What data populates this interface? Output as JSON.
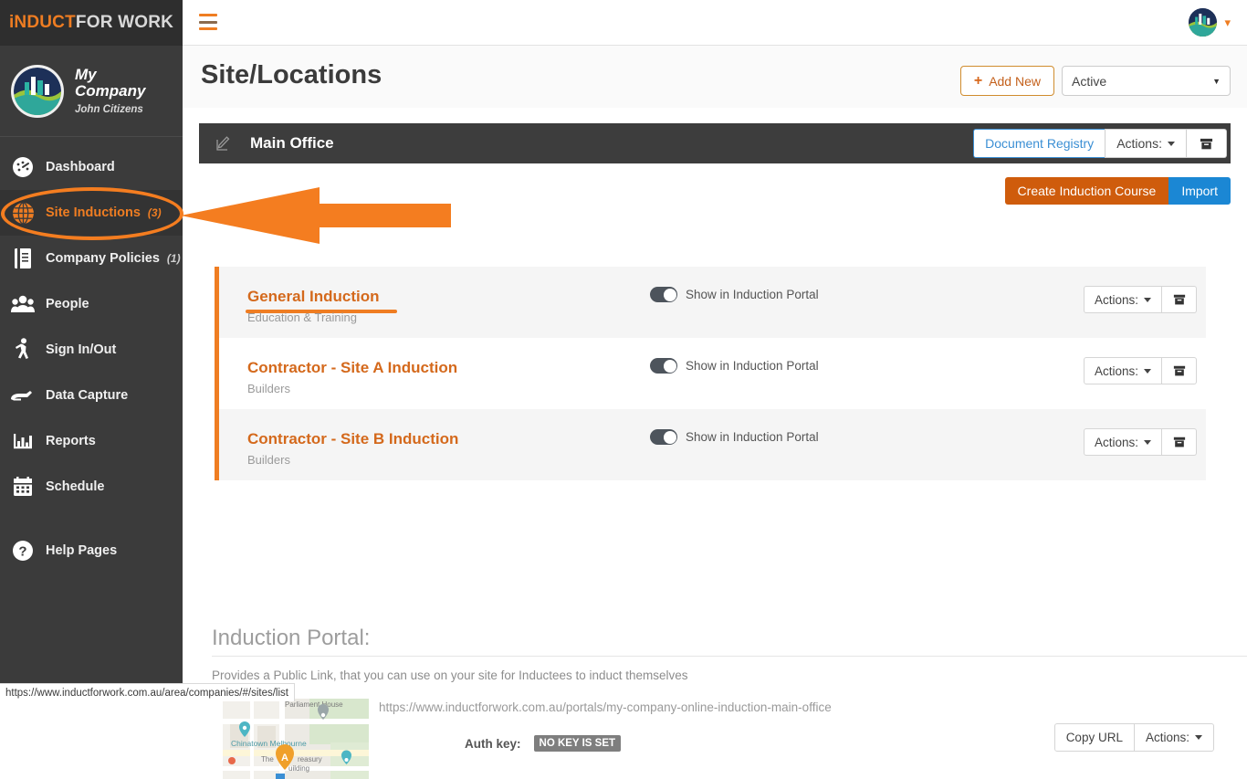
{
  "brand": {
    "prefix": "i",
    "main": "NDUCT",
    "suffix": "FOR WORK"
  },
  "company": {
    "name": "My Company",
    "user": "John Citizens"
  },
  "sidebar": {
    "items": [
      {
        "label": "Dashboard",
        "count": "",
        "icon": "dashboard-icon",
        "active": false
      },
      {
        "label": "Site Inductions",
        "count": "(3)",
        "icon": "globe-icon",
        "active": true
      },
      {
        "label": "Company Policies",
        "count": "(1)",
        "icon": "book-icon",
        "active": false
      },
      {
        "label": "People",
        "count": "",
        "icon": "people-icon",
        "active": false
      },
      {
        "label": "Sign In/Out",
        "count": "",
        "icon": "walking-icon",
        "active": false
      },
      {
        "label": "Data Capture",
        "count": "",
        "icon": "hand-icon",
        "active": false
      },
      {
        "label": "Reports",
        "count": "",
        "icon": "bar-chart-icon",
        "active": false
      },
      {
        "label": "Schedule",
        "count": "",
        "icon": "calendar-icon",
        "active": false
      },
      {
        "label": "Help Pages",
        "count": "",
        "icon": "question-circle-icon",
        "active": false
      }
    ]
  },
  "page": {
    "title": "Site/Locations",
    "add_new_label": "Add New",
    "status_filter_value": "Active"
  },
  "site_panel": {
    "name": "Main Office",
    "document_registry_label": "Document Registry",
    "actions_label": "Actions:",
    "create_course_label": "Create Induction Course",
    "import_label": "Import"
  },
  "courses": [
    {
      "name": "General Induction",
      "category": "Education & Training",
      "toggle_label": "Show in Induction Portal",
      "toggle_on": true,
      "actions_label": "Actions:",
      "shaded": true,
      "highlighted": true
    },
    {
      "name": "Contractor - Site A Induction",
      "category": "Builders",
      "toggle_label": "Show in Induction Portal",
      "toggle_on": true,
      "actions_label": "Actions:",
      "shaded": false,
      "highlighted": false
    },
    {
      "name": "Contractor - Site B Induction",
      "category": "Builders",
      "toggle_label": "Show in Induction Portal",
      "toggle_on": true,
      "actions_label": "Actions:",
      "shaded": true,
      "highlighted": false
    }
  ],
  "portal": {
    "title": "Induction Portal:",
    "description": "Provides a Public Link, that you can use on your site for Inductees to induct themselves",
    "url": "https://www.inductforwork.com.au/portals/my-company-online-induction-main-office",
    "auth_key_label": "Auth key:",
    "auth_key_value": "NO KEY IS SET",
    "copy_url_label": "Copy URL",
    "actions_label": "Actions:",
    "map_labels": {
      "parliament_house": "Parliament House",
      "chinatown": "Chinatown Melbourne",
      "treasury": "The Treasury Building",
      "marker": "A"
    }
  },
  "status_bar": {
    "url": "https://www.inductforwork.com.au/area/companies/#/sites/list"
  },
  "colors": {
    "brand_orange": "#ef7d22",
    "annotation_orange": "#f47d20",
    "sidebar_dark": "#3b3b3b",
    "panel_dark": "#3d3d3d",
    "create_button": "#cf5c0c",
    "import_button": "#1b87d4",
    "link_blue": "#3b8fd4"
  }
}
